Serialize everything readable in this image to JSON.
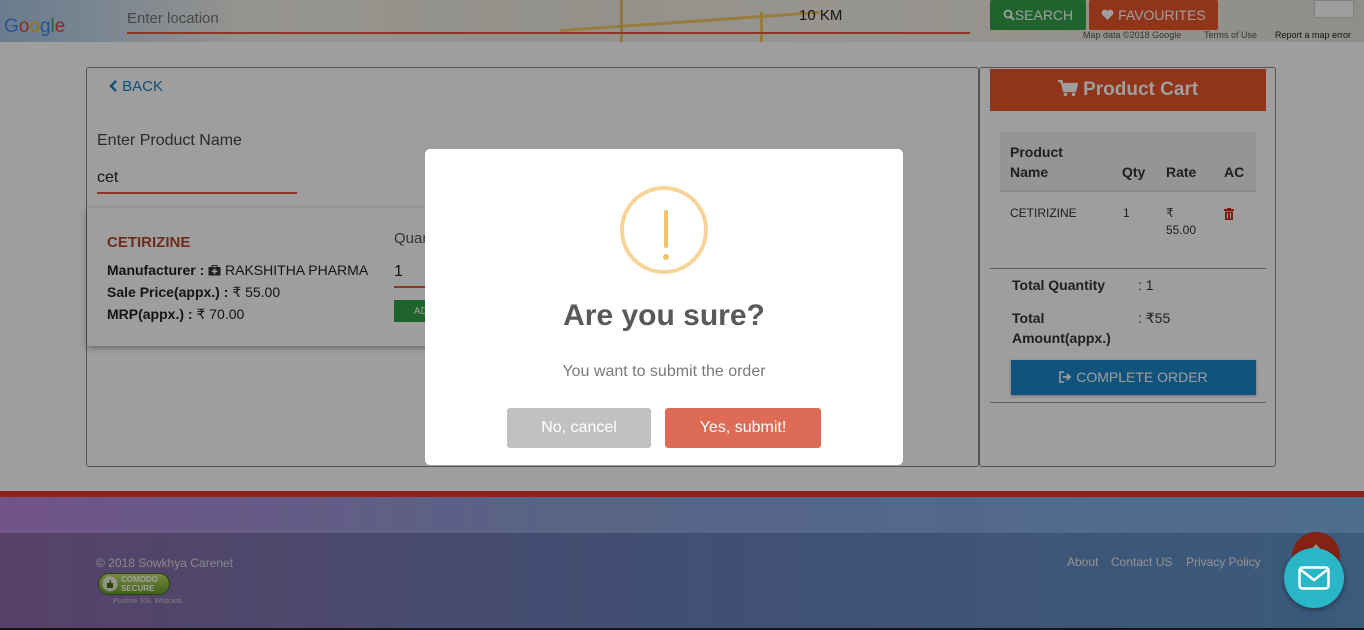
{
  "header": {
    "location_placeholder": "Enter location",
    "radius": "10 KM",
    "search_label": "SEARCH",
    "favourites_label": "FAVOURITES",
    "map_logo": "Google",
    "map_attribution": "Map data ©2018 Google",
    "terms": "Terms of Use",
    "report": "Report a map error"
  },
  "product_search": {
    "back_label": "BACK",
    "label": "Enter Product Name",
    "value": "cet"
  },
  "result": {
    "name": "CETIRIZINE",
    "manufacturer_label": "Manufacturer :",
    "manufacturer": "RAKSHITHA PHARMA",
    "sale_price_label": "Sale Price(appx.) :",
    "sale_price": "₹ 55.00",
    "mrp_label": "MRP(appx.) :",
    "mrp": "₹ 70.00",
    "quantity_label": "Quantity",
    "quantity_value": "1",
    "add_label": "ADD"
  },
  "cart": {
    "title": "Product Cart",
    "headers": {
      "name_line1": "Product",
      "name_line2": "Name",
      "qty": "Qty",
      "rate": "Rate",
      "action": "AC"
    },
    "items": [
      {
        "name": "CETIRIZINE",
        "qty": "1",
        "rate_symbol": "₹",
        "rate": "55.00"
      }
    ],
    "total_quantity_label": "Total Quantity",
    "total_quantity": ": 1",
    "total_amount_label_line1": "Total",
    "total_amount_label_line2": "Amount(appx.)",
    "total_amount": ": ₹55",
    "complete_label": "COMPLETE ORDER"
  },
  "footer": {
    "copyright": "© 2018 Sowkhya Carenet",
    "badge_line1": "COMODO",
    "badge_line2": "SECURE",
    "badge_sub": "Positive SSL Wildcard",
    "links": [
      "About",
      "Contact US",
      "Privacy Policy"
    ]
  },
  "modal": {
    "title": "Are you sure?",
    "text": "You want to submit the order",
    "cancel_label": "No, cancel",
    "confirm_label": "Yes, submit!"
  },
  "colors": {
    "accent_orange": "#e8552b",
    "search_green": "#33a04a",
    "primary_blue": "#1a86c8",
    "confirm_button": "#dd6b55",
    "warning": "#f5c26b"
  },
  "icons": [
    "search-icon",
    "heart-icon",
    "chevron-left-icon",
    "medical-kit-icon",
    "cart-icon",
    "trash-icon",
    "sign-out-icon",
    "warning-icon",
    "mail-icon",
    "chevron-up-icon"
  ]
}
